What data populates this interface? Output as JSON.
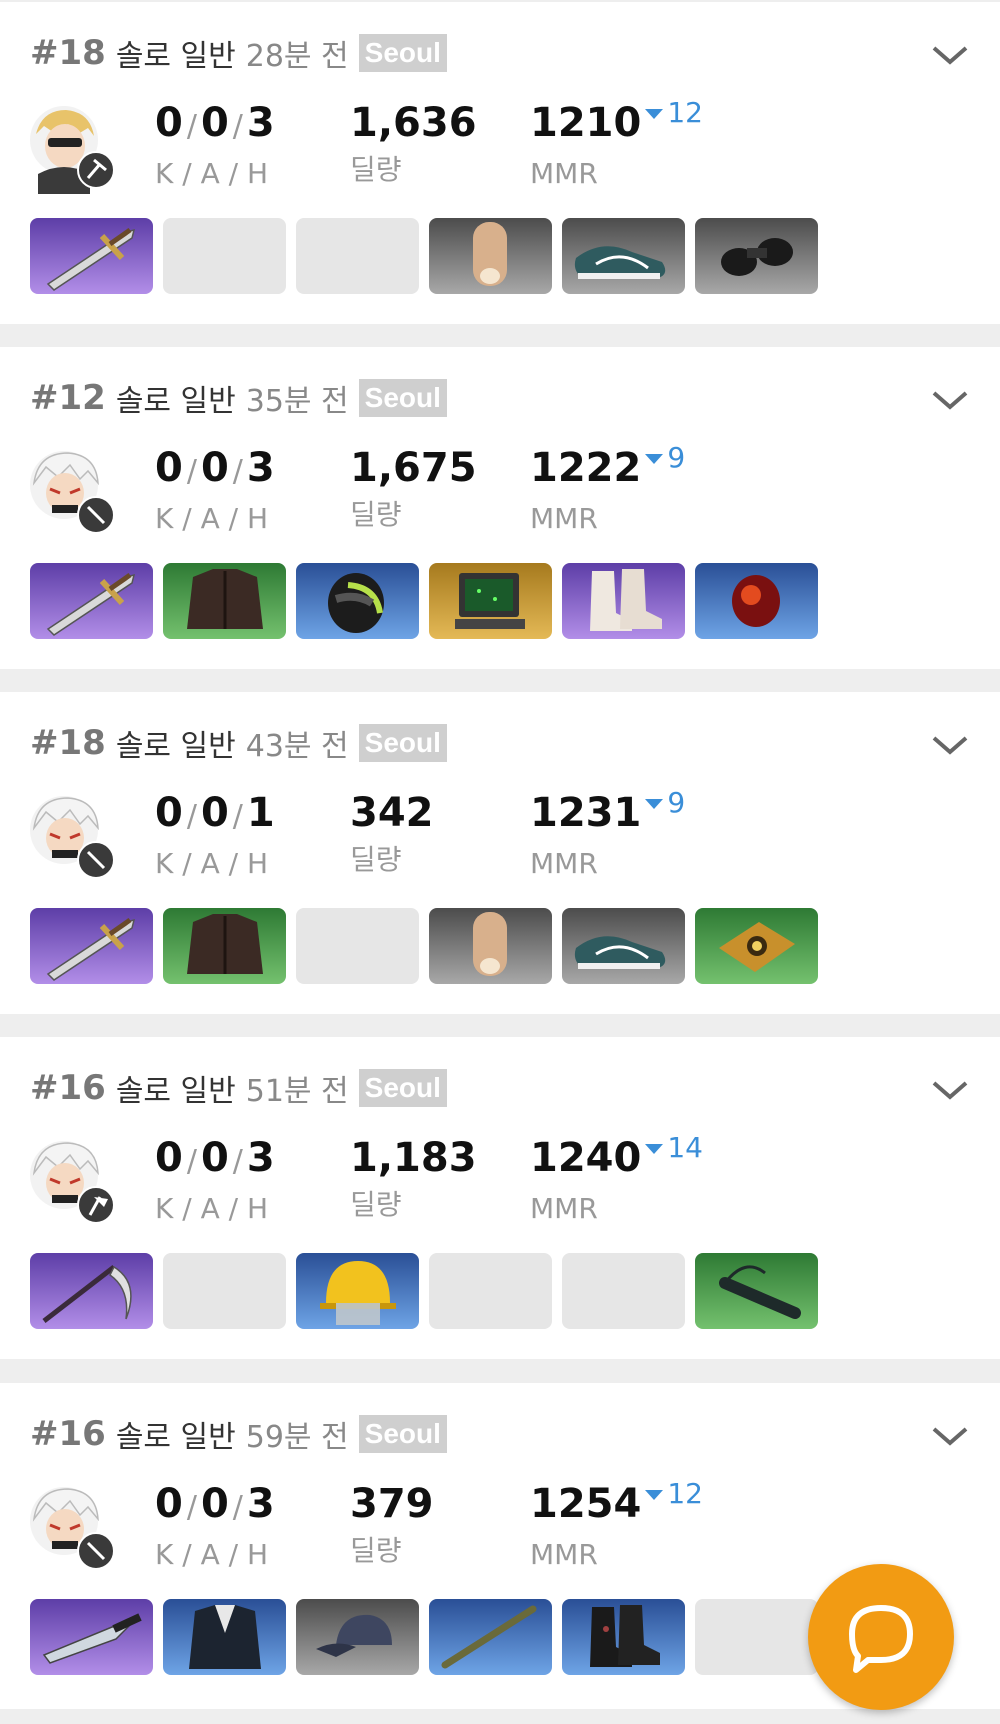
{
  "matches": [
    {
      "rank": "#18",
      "mode": "솔로 일반",
      "ago": "28분 전",
      "region": "Seoul",
      "kills": "0",
      "assists": "0",
      "hunts": "3",
      "kah_label": "K / A / H",
      "damage": "1,636",
      "damage_label": "딜량",
      "mmr": "1210",
      "mmr_change": "12",
      "mmr_label": "MMR",
      "character_icon": "blonde-character-sunglasses",
      "weapon_badge_icon": "hammer-icon",
      "items": [
        {
          "rarity": "purple",
          "icon": "sword-icon"
        },
        {
          "rarity": "empty",
          "icon": ""
        },
        {
          "rarity": "empty",
          "icon": ""
        },
        {
          "rarity": "gray",
          "icon": "bandage-roll-icon"
        },
        {
          "rarity": "gray",
          "icon": "sneakers-icon"
        },
        {
          "rarity": "gray",
          "icon": "binoculars-icon"
        }
      ]
    },
    {
      "rank": "#12",
      "mode": "솔로 일반",
      "ago": "35분 전",
      "region": "Seoul",
      "kills": "0",
      "assists": "0",
      "hunts": "3",
      "kah_label": "K / A / H",
      "damage": "1,675",
      "damage_label": "딜량",
      "mmr": "1222",
      "mmr_change": "9",
      "mmr_label": "MMR",
      "character_icon": "white-hair-character",
      "weapon_badge_icon": "dagger-icon",
      "items": [
        {
          "rarity": "purple",
          "icon": "sword-icon"
        },
        {
          "rarity": "green",
          "icon": "leather-jacket-icon"
        },
        {
          "rarity": "blue",
          "icon": "motorcycle-helmet-icon"
        },
        {
          "rarity": "gold",
          "icon": "radar-device-icon"
        },
        {
          "rarity": "purple",
          "icon": "boots-icon"
        },
        {
          "rarity": "blue",
          "icon": "red-gem-icon"
        }
      ]
    },
    {
      "rank": "#18",
      "mode": "솔로 일반",
      "ago": "43분 전",
      "region": "Seoul",
      "kills": "0",
      "assists": "0",
      "hunts": "1",
      "kah_label": "K / A / H",
      "damage": "342",
      "damage_label": "딜량",
      "mmr": "1231",
      "mmr_change": "9",
      "mmr_label": "MMR",
      "character_icon": "white-hair-character",
      "weapon_badge_icon": "dagger-icon",
      "items": [
        {
          "rarity": "purple",
          "icon": "sword-icon"
        },
        {
          "rarity": "green",
          "icon": "leather-jacket-icon"
        },
        {
          "rarity": "empty",
          "icon": ""
        },
        {
          "rarity": "gray",
          "icon": "bandage-roll-icon"
        },
        {
          "rarity": "gray",
          "icon": "sneakers-icon"
        },
        {
          "rarity": "green",
          "icon": "book-icon"
        }
      ]
    },
    {
      "rank": "#16",
      "mode": "솔로 일반",
      "ago": "51분 전",
      "region": "Seoul",
      "kills": "0",
      "assists": "0",
      "hunts": "3",
      "kah_label": "K / A / H",
      "damage": "1,183",
      "damage_label": "딜량",
      "mmr": "1240",
      "mmr_change": "14",
      "mmr_label": "MMR",
      "character_icon": "white-hair-character",
      "weapon_badge_icon": "axe-icon",
      "items": [
        {
          "rarity": "purple",
          "icon": "scythe-icon"
        },
        {
          "rarity": "empty",
          "icon": ""
        },
        {
          "rarity": "blue",
          "icon": "fire-helmet-icon"
        },
        {
          "rarity": "empty",
          "icon": ""
        },
        {
          "rarity": "empty",
          "icon": ""
        },
        {
          "rarity": "green",
          "icon": "quiver-icon"
        }
      ]
    },
    {
      "rank": "#16",
      "mode": "솔로 일반",
      "ago": "59분 전",
      "region": "Seoul",
      "kills": "0",
      "assists": "0",
      "hunts": "3",
      "kah_label": "K / A / H",
      "damage": "379",
      "damage_label": "딜량",
      "mmr": "1254",
      "mmr_change": "12",
      "mmr_label": "MMR",
      "character_icon": "white-hair-character",
      "weapon_badge_icon": "dagger-icon",
      "items": [
        {
          "rarity": "purple",
          "icon": "knife-icon"
        },
        {
          "rarity": "blue",
          "icon": "suit-jacket-icon"
        },
        {
          "rarity": "gray",
          "icon": "baseball-cap-icon"
        },
        {
          "rarity": "blue",
          "icon": "stick-icon"
        },
        {
          "rarity": "blue",
          "icon": "combat-boots-icon"
        },
        {
          "rarity": "empty",
          "icon": ""
        }
      ]
    }
  ],
  "colors": {
    "mmr_change": "#3a8ed8",
    "fab": "#f29b13",
    "region_badge": "#cfcfcf"
  },
  "fab_icon": "chat-bubble-icon"
}
